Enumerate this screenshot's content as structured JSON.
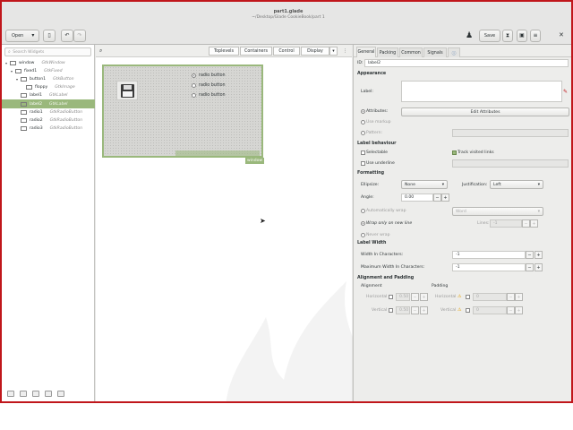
{
  "header": {
    "open_label": "Open",
    "title": "part1.glade",
    "subtitle": "~/Desktop/Glade CookieBook/part 1",
    "save_label": "Save"
  },
  "left": {
    "search_placeholder": "Search Widgets",
    "tree": [
      {
        "name": "window",
        "type": "GtkWindow",
        "depth": 0,
        "expander": "▾",
        "icon": "window-icon",
        "selected": false
      },
      {
        "name": "fixed1",
        "type": "GtkFixed",
        "depth": 1,
        "expander": "▾",
        "icon": "fixed-icon",
        "selected": false
      },
      {
        "name": "button1",
        "type": "GtkButton",
        "depth": 2,
        "expander": "▾",
        "icon": "button-icon",
        "selected": false
      },
      {
        "name": "floppy",
        "type": "GtkImage",
        "depth": 3,
        "expander": "",
        "icon": "image-icon",
        "selected": false
      },
      {
        "name": "label1",
        "type": "GtkLabel",
        "depth": 2,
        "expander": "",
        "icon": "label-icon",
        "selected": false
      },
      {
        "name": "label2",
        "type": "GtkLabel",
        "depth": 2,
        "expander": "",
        "icon": "label-icon",
        "selected": true
      },
      {
        "name": "radio1",
        "type": "GtkRadioButton",
        "depth": 2,
        "expander": "",
        "icon": "radio-icon",
        "selected": false
      },
      {
        "name": "radio2",
        "type": "GtkRadioButton",
        "depth": 2,
        "expander": "",
        "icon": "radio-icon",
        "selected": false
      },
      {
        "name": "radio3",
        "type": "GtkRadioButton",
        "depth": 2,
        "expander": "",
        "icon": "radio-icon",
        "selected": false
      }
    ]
  },
  "center": {
    "tabs": [
      "Toplevels",
      "Containers",
      "Control",
      "Display"
    ],
    "radios": [
      "radio button",
      "radio button",
      "radio button"
    ],
    "window_label": "window"
  },
  "right": {
    "tabs": [
      "General",
      "Packing",
      "Common",
      "Signals"
    ],
    "id_label": "ID:",
    "id_value": "label2",
    "appearance": "Appearance",
    "label_label": "Label:",
    "attributes_label": "Attributes:",
    "edit_attributes": "Edit Attributes",
    "use_markup": "Use markup",
    "pattern": "Pattern:",
    "label_behaviour": "Label behaviour",
    "selectable": "Selectable",
    "track_visited": "Track visited links",
    "use_underline": "Use underline",
    "formatting": "Formatting",
    "ellipsize_label": "Ellipsize:",
    "ellipsize_value": "None",
    "justification_label": "Justification:",
    "justification_value": "Left",
    "angle_label": "Angle:",
    "angle_value": "0.00",
    "auto_wrap": "Automatically wrap",
    "wrap_mode_value": "Word",
    "wrap_new_line": "Wrap only on new line",
    "lines_label": "Lines:",
    "lines_value": "-1",
    "never_wrap": "Never wrap",
    "label_width": "Label Width",
    "width_chars_label": "Width In Characters:",
    "width_chars_value": "-1",
    "max_width_label": "Maximum Width In Characters:",
    "max_width_value": "-1",
    "align_padding": "Alignment and Padding",
    "alignment": "Alignment",
    "padding": "Padding",
    "horizontal": "Horizontal",
    "vertical": "Vertical",
    "h_align_value": "0.50",
    "v_align_value": "0.50",
    "h_pad_value": "0",
    "v_pad_value": "0"
  }
}
